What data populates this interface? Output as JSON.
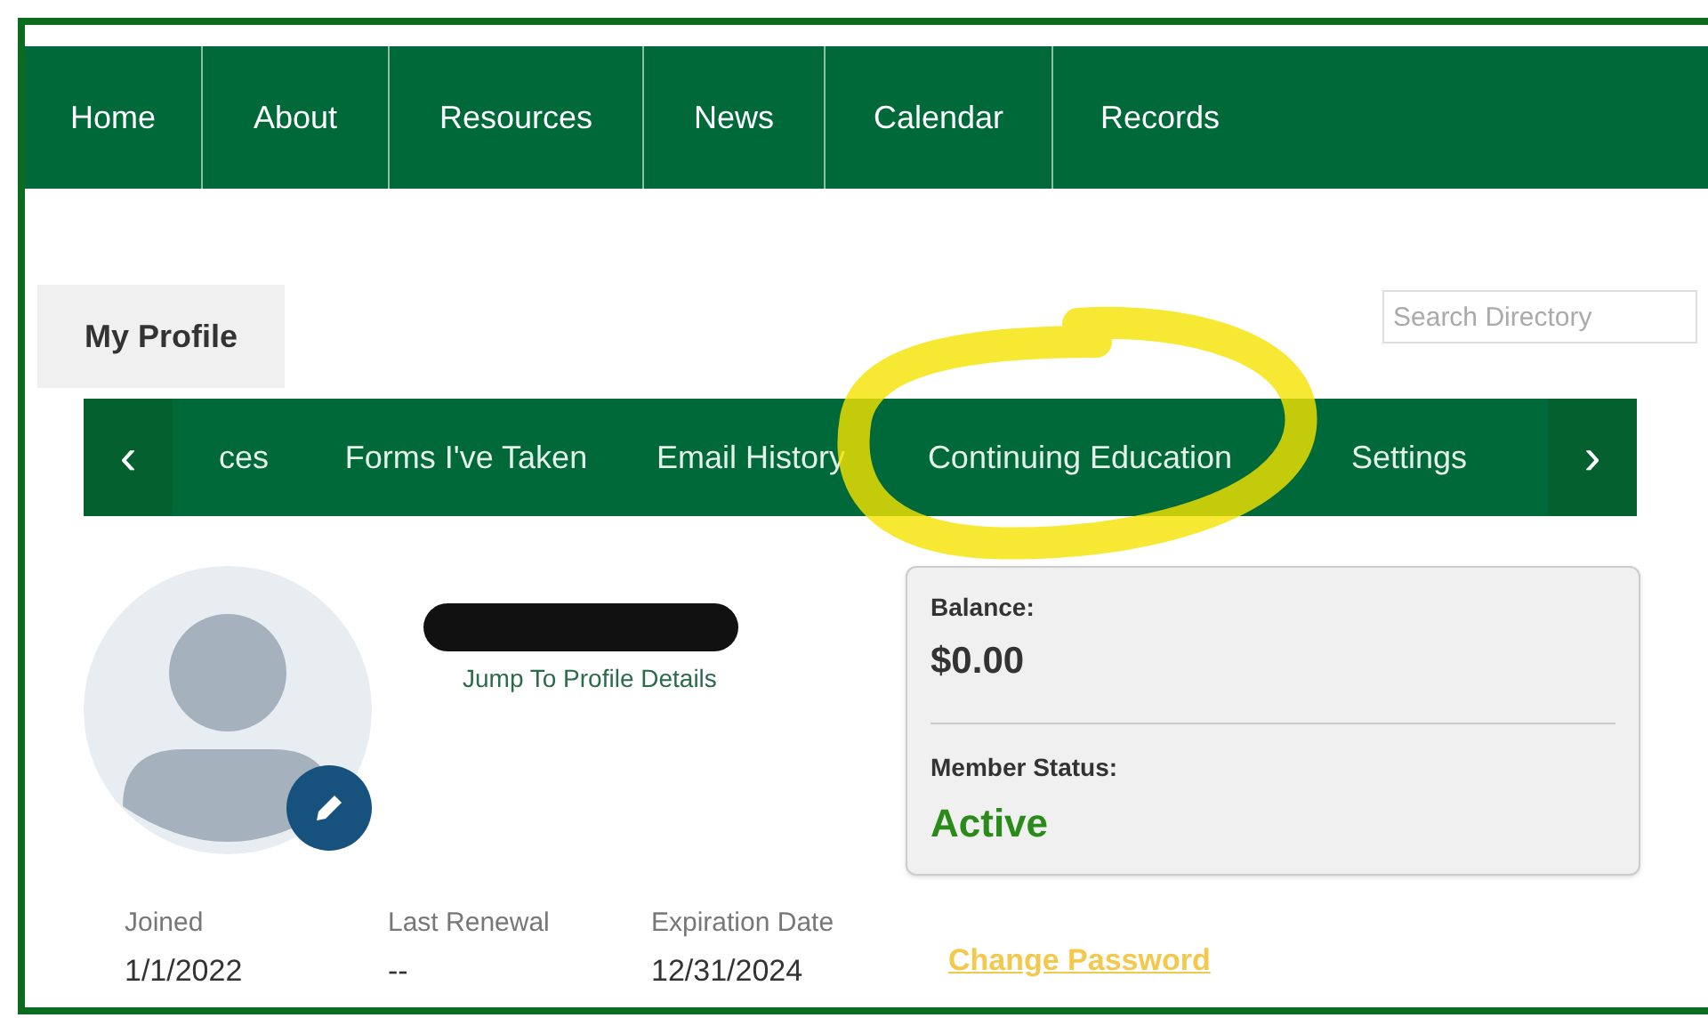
{
  "nav": [
    {
      "label": "Home"
    },
    {
      "label": "About"
    },
    {
      "label": "Resources"
    },
    {
      "label": "News"
    },
    {
      "label": "Calendar"
    },
    {
      "label": "Records"
    }
  ],
  "profile_tab": {
    "label": "My Profile"
  },
  "search": {
    "placeholder": "Search Directory"
  },
  "subnav": {
    "prev": "‹",
    "next": "›",
    "items": [
      {
        "label": "ces"
      },
      {
        "label": "Forms I've Taken"
      },
      {
        "label": "Email History"
      },
      {
        "label": "Continuing Education"
      },
      {
        "label": "Settings"
      }
    ]
  },
  "profile": {
    "link": "Jump To Profile Details"
  },
  "account": {
    "balance_label": "Balance:",
    "balance": "$0.00",
    "status_label": "Member Status:",
    "status": "Active"
  },
  "dates": [
    {
      "label": "Joined",
      "value": "1/1/2022"
    },
    {
      "label": "Last Renewal",
      "value": "--"
    },
    {
      "label": "Expiration Date",
      "value": "12/31/2024"
    }
  ],
  "change_password": "Change Password"
}
